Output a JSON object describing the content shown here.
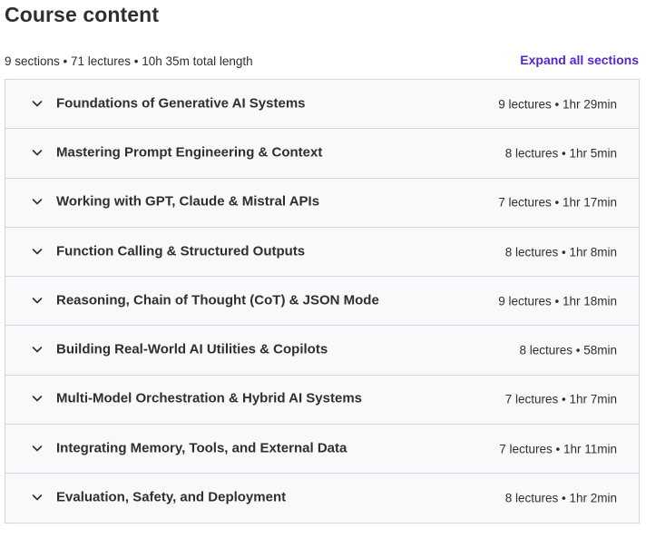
{
  "header": {
    "title": "Course content",
    "summary": "9 sections • 71 lectures • 10h 35m total length",
    "expand_all_label": "Expand all sections"
  },
  "colors": {
    "accent": "#5624d0",
    "section_bg": "#f7f9fa",
    "border": "#d1d7dc",
    "text": "#2d2f31"
  },
  "sections": [
    {
      "title": "Foundations of Generative AI Systems",
      "meta": "9 lectures • 1hr 29min",
      "icon": "chevron-down-icon"
    },
    {
      "title": "Mastering Prompt Engineering & Context",
      "meta": "8 lectures • 1hr 5min",
      "icon": "chevron-down-icon"
    },
    {
      "title": "Working with GPT, Claude & Mistral APIs",
      "meta": "7 lectures • 1hr 17min",
      "icon": "chevron-down-icon"
    },
    {
      "title": "Function Calling & Structured Outputs",
      "meta": "8 lectures • 1hr 8min",
      "icon": "chevron-down-icon"
    },
    {
      "title": "Reasoning, Chain of Thought (CoT) & JSON Mode",
      "meta": "9 lectures • 1hr 18min",
      "icon": "chevron-down-icon"
    },
    {
      "title": "Building Real-World AI Utilities & Copilots",
      "meta": "8 lectures • 58min",
      "icon": "chevron-down-icon"
    },
    {
      "title": "Multi-Model Orchestration & Hybrid AI Systems",
      "meta": "7 lectures • 1hr 7min",
      "icon": "chevron-down-icon"
    },
    {
      "title": "Integrating Memory, Tools, and External Data",
      "meta": "7 lectures • 1hr 11min",
      "icon": "chevron-down-icon"
    },
    {
      "title": "Evaluation, Safety, and Deployment",
      "meta": "8 lectures • 1hr 2min",
      "icon": "chevron-down-icon"
    }
  ]
}
